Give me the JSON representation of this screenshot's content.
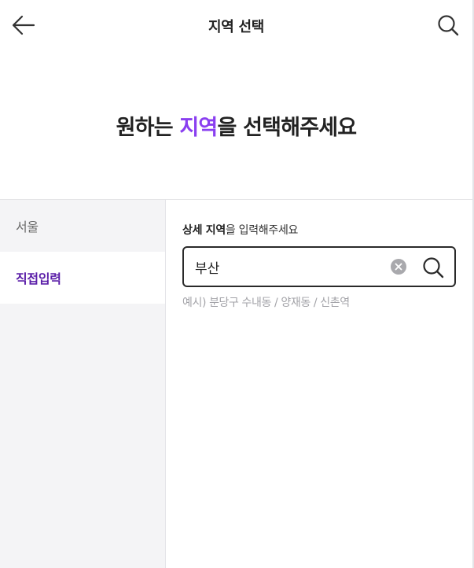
{
  "header": {
    "title": "지역 선택",
    "back_icon": "arrow-left-icon",
    "search_icon": "search-icon"
  },
  "hero": {
    "title_before": "원하는 ",
    "title_accent": "지역",
    "title_after": "을 선택해주세요",
    "accent_color": "#8a3ff0"
  },
  "sidebar": {
    "items": [
      {
        "label": "서울",
        "active": false
      },
      {
        "label": "직접입력",
        "active": true
      }
    ],
    "active_color": "#5b1ea8"
  },
  "detail": {
    "label_bold": "상세 지역",
    "label_rest": "을 입력해주세요",
    "input_value": "부산",
    "hint": "예시) 분당구 수내동 / 양재동 / 신촌역"
  }
}
